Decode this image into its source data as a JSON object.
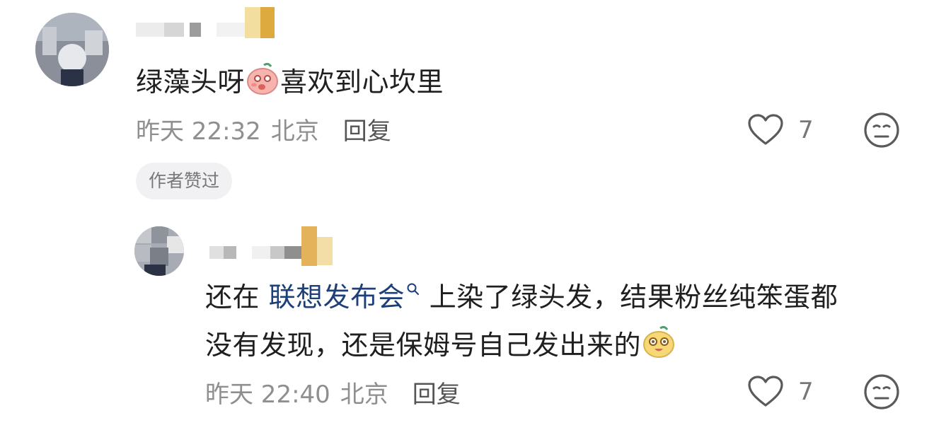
{
  "comments": [
    {
      "text_before": "绿藻头呀",
      "emoji": "shy-face-emoji",
      "text_after": "喜欢到心坎里",
      "meta": {
        "time": "昨天 22:32",
        "location": "北京",
        "reply": "回复"
      },
      "likes": "7",
      "badge": "作者赞过"
    },
    {
      "line1_prefix": "还在 ",
      "link_text": "联想发布会",
      "line1_suffix": " 上染了绿头发，结果粉丝纯笨蛋都",
      "line2": "没有发现，还是保姆号自己发出来的",
      "emoji": "laugh-face-emoji",
      "meta": {
        "time": "昨天 22:40",
        "location": "北京",
        "reply": "回复"
      },
      "likes": "7"
    }
  ],
  "colors": {
    "link": "#1d3f7a",
    "meta": "#8f8f8f",
    "badge_bg": "#f1f1f3"
  }
}
